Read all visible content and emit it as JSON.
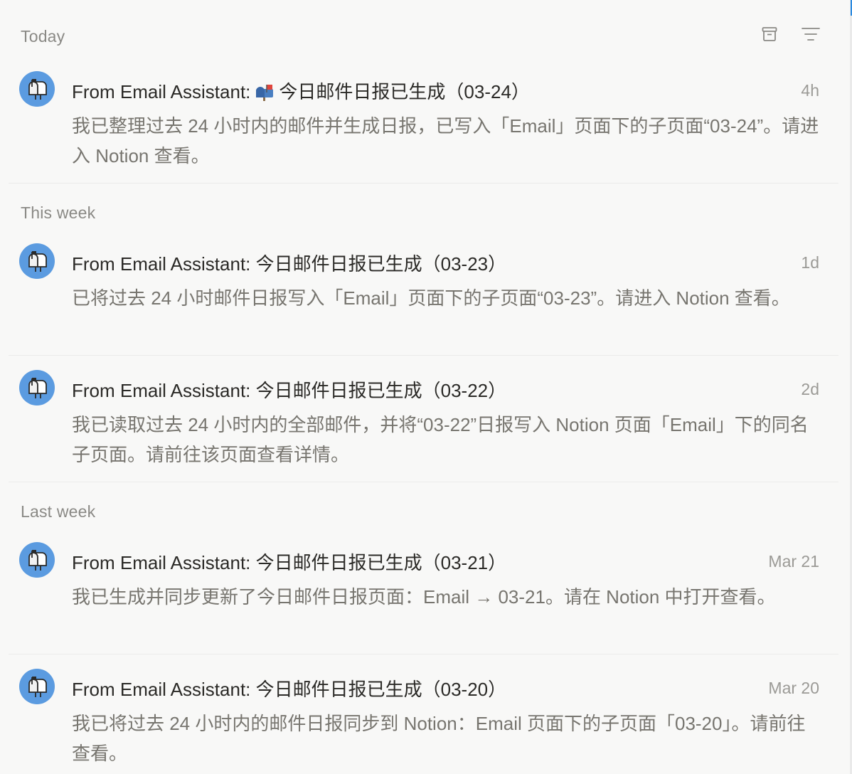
{
  "header": {
    "archive_icon": "archive-box-icon",
    "filter_icon": "filter-lines-icon"
  },
  "sections": [
    {
      "label": "Today",
      "items": [
        {
          "title_prefix": "From Email Assistant:",
          "title_emoji": "mailbox-emoji",
          "title_text": "今日邮件日报已生成（03-24）",
          "time": "4h",
          "body": "我已整理过去 24 小时内的邮件并生成日报，已写入「Email」页面下的子页面“03-24”。请进入 Notion 查看。"
        }
      ]
    },
    {
      "label": "This week",
      "items": [
        {
          "title_prefix": "From Email Assistant:",
          "title_text": "今日邮件日报已生成（03-23）",
          "time": "1d",
          "body": "已将过去 24 小时邮件日报写入「Email」页面下的子页面“03-23”。请进入 Notion 查看。"
        },
        {
          "title_prefix": "From Email Assistant:",
          "title_text": "今日邮件日报已生成（03-22）",
          "time": "2d",
          "body": "我已读取过去 24 小时内的全部邮件，并将“03-22”日报写入 Notion 页面「Email」下的同名子页面。请前往该页面查看详情。"
        }
      ]
    },
    {
      "label": "Last week",
      "items": [
        {
          "title_prefix": "From Email Assistant:",
          "title_text": "今日邮件日报已生成（03-21）",
          "time": "Mar 21",
          "body": "我已生成并同步更新了今日邮件日报页面：Email → 03-21。请在 Notion 中打开查看。"
        },
        {
          "title_prefix": "From Email Assistant:",
          "title_text": "今日邮件日报已生成（03-20）",
          "time": "Mar 20",
          "body": "我已将过去 24 小时内的邮件日报同步到 Notion：Email 页面下的子页面「03-20」。请前往查看。"
        }
      ]
    }
  ],
  "colors": {
    "background": "#f8f8f7",
    "avatar": "#5b9be0",
    "title": "#2b2a27",
    "body": "#77756f",
    "muted": "#8a8985",
    "divider": "#ebebea"
  }
}
